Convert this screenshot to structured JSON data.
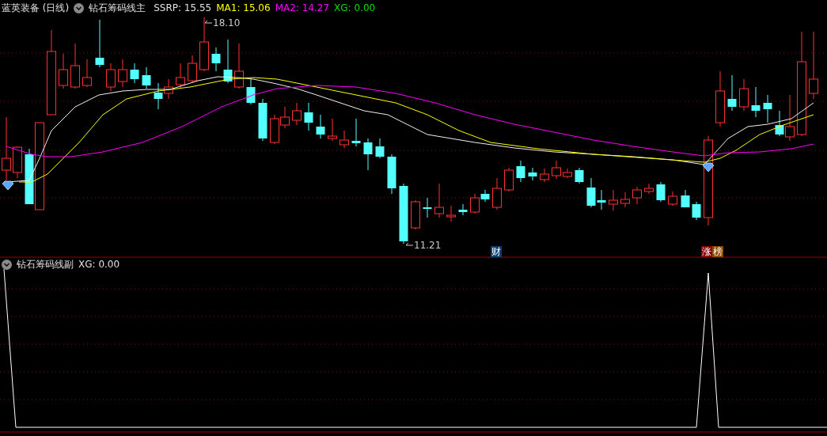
{
  "main_panel": {
    "stock": "蓝英装备 (日线)",
    "indicator": "钻石筹码线主",
    "readings": [
      {
        "text": "SSRP: 15.55",
        "color": "#e0e0e0"
      },
      {
        "text": "MA1: 15.06",
        "color": "#ffff00"
      },
      {
        "text": "MA2: 14.27",
        "color": "#ff00ff"
      },
      {
        "text": "XG: 0.00",
        "color": "#00e000"
      }
    ],
    "price_labels": [
      {
        "kind": "high",
        "text": "18.10"
      },
      {
        "kind": "low",
        "text": "11.21"
      }
    ],
    "badges": [
      {
        "text": "财",
        "color": "#0b3d6e"
      },
      {
        "text": "涨",
        "color": "#8a0000"
      },
      {
        "text": "榜",
        "color": "#8a4a00"
      }
    ]
  },
  "sub_panel": {
    "indicator": "钻石筹码线副",
    "readings": [
      {
        "text": "XG: 0.00",
        "color": "#e0e0e0"
      }
    ]
  }
}
